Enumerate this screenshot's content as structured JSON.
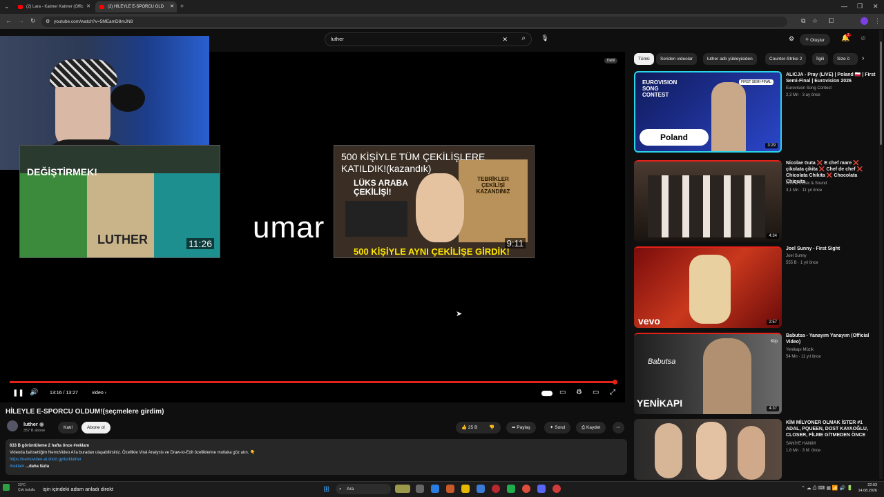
{
  "browser": {
    "tabs": [
      {
        "label": "(2) Lara - Katmer Katmer (Offic"
      },
      {
        "label": "(2) HİLEYLE E-SPORCU OLD"
      }
    ],
    "url": "youtube.com/watch?v=5MEamD8mJN8",
    "new_tab": "+"
  },
  "header": {
    "search_value": "luther",
    "create_label": "Oluştur",
    "notif_count": "2"
  },
  "player": {
    "overlay_text": "umar",
    "time": "13:16 / 13:27",
    "chapter": "video",
    "end_left_caption": "DEĞİŞTİRMEK!",
    "end_left_duration": "11:26",
    "end_left_luther": "LUTHER",
    "end_right_title": "500 KİŞİYLE TÜM ÇEKİLİŞLERE KATILDIK!(kazandık)",
    "end_right_duration": "9:11",
    "end_right_sub": "500 KİŞİYLE AYNI ÇEKİLİŞE GİRDİK!",
    "end_right_badge1": "LÜKS ARABA ÇEKİLİŞİ!",
    "end_right_badge2": "TEBRİKLER ÇEKİLİŞİ KAZANDINIZ",
    "top_right_badge": "Dahil",
    "progress_fraction": 0.99
  },
  "video": {
    "title": "HİLEYLE E-SPORCU OLDUM!(seçmelere girdim)",
    "channel": "luther",
    "subs": "357 B abone",
    "join": "Katıl",
    "subscribe": "Abone ol",
    "likes": "25 B",
    "share": "Paylaş",
    "ask": "Sorul",
    "save": "Kaydet"
  },
  "description": {
    "line1": "633 B görüntüleme  2 hafta önce  #reklam",
    "line2": "Videoda bahsettiğim NemoVideo AI'a buradan ulaşabilirsiniz. Özellikle Viral Analysis ve Draw-to-Edit özelliklerine mutlaka göz atın. 👇",
    "line3": "https://nemovideo-ai.short.gy/turkluther",
    "line4": "#reklam",
    "more": "...daha fazla"
  },
  "chips": [
    "Tümü",
    "Seriden videolar",
    "luther adlı yükleyiciden",
    "Counter-Strike 2",
    "İlgili",
    "Size ö"
  ],
  "sidebar": [
    {
      "title": "ALICJA - Pray (LIVE) | Poland 🇵🇱 | First Semi-Final | Eurovision 2026",
      "channel": "Eurovision Song Contest",
      "meta": "2,3 Mn  ·  3 ay önce",
      "duration": "3:29",
      "thumb_text": "Poland",
      "thumb_text2": "EUROVISION SONG CONTEST",
      "thumb_text3": "FIRST SEMI-FINAL"
    },
    {
      "title": "Nicolae Guta ❌ E chef mare ❌ çikolata çikita ❌ Chef de chef ❌ Chicolata Chikita ❌ Chocolata Chiquita",
      "channel": "Amma Music & Sound",
      "meta": "3,1 Mn  ·  11 yıl önce",
      "duration": "4:34"
    },
    {
      "title": "Joel Sunny - First Sight",
      "channel": "Joel Sunny",
      "meta": "555 B  ·  1 yıl önce",
      "duration": "2:57",
      "thumb_text": "vevo"
    },
    {
      "title": "Babutsa - Yanayım Yanayım (Official Video)",
      "channel": "Yenikapı Müzik",
      "meta": "54 Mn  ·  11 yıl önce",
      "duration": "4:37",
      "thumb_text": "YENİKAPI",
      "thumb_text2": "Babutsa",
      "thumb_text3": "Klip"
    },
    {
      "title": "KİM MİLYONER OLMAK İSTER #1 ADAL, PQUEEN, DOST KAYAOĞLU, CLOSER, FİLME GİTMEDEN ÖNCE",
      "channel": "SANİYE HANIM",
      "meta": "1,6 Mn  ·  3 hf. önce",
      "duration": ""
    }
  ],
  "taskbar": {
    "weather": "23°C",
    "weather_sub": "Çok bulutlu",
    "notice": "işin içindeki adam anladı direkt",
    "search": "Ara",
    "time": "22:03",
    "date": "14.08.2026"
  }
}
